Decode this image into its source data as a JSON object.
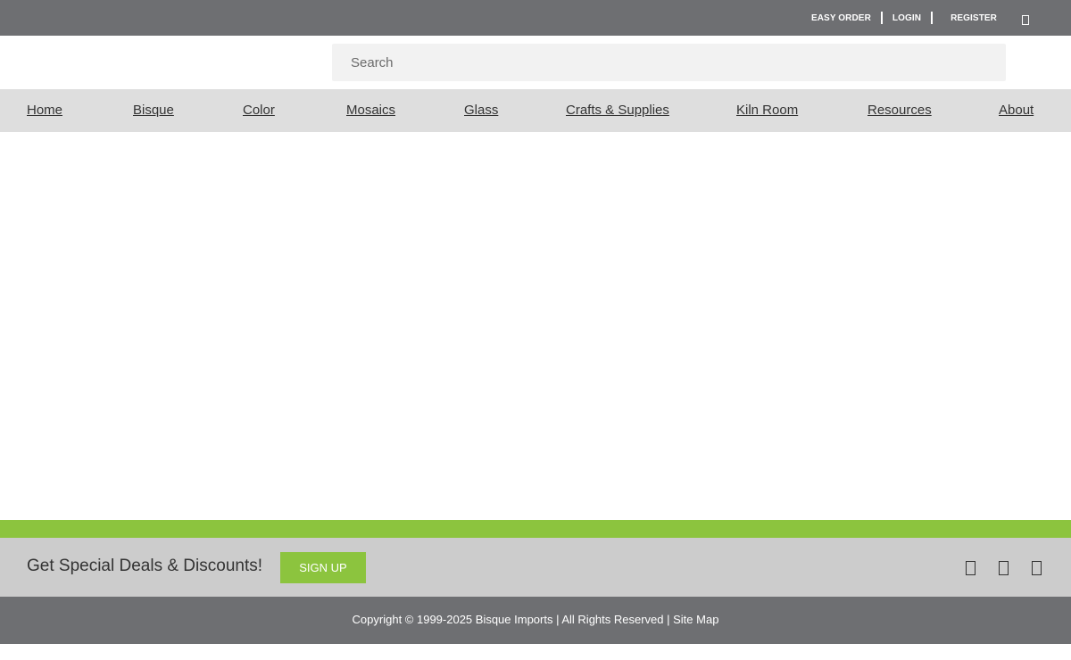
{
  "topbar": {
    "easy_order": "EASY ORDER",
    "login": "LOGIN",
    "register": "REGISTER",
    "cart_icon": "cart-icon"
  },
  "search": {
    "placeholder": "Search"
  },
  "nav": {
    "items": [
      {
        "label": "Home"
      },
      {
        "label": "Bisque"
      },
      {
        "label": "Color"
      },
      {
        "label": "Mosaics"
      },
      {
        "label": "Glass"
      },
      {
        "label": "Crafts & Supplies"
      },
      {
        "label": "Kiln Room"
      },
      {
        "label": "Resources"
      },
      {
        "label": "About"
      }
    ]
  },
  "signup": {
    "text": "Get Special Deals & Discounts!",
    "button": "SIGN UP",
    "social_icons": [
      "facebook-icon",
      "pinterest-icon",
      "instagram-icon"
    ]
  },
  "footer": {
    "copyright": "Copyright © 1999-2025 Bisque Imports | All Rights Reserved |",
    "sitemap": "Site Map"
  },
  "colors": {
    "topbar": "#6e6f72",
    "nav": "#dedede",
    "accent_green": "#8cc43e",
    "signup_bg": "#cccccc"
  }
}
